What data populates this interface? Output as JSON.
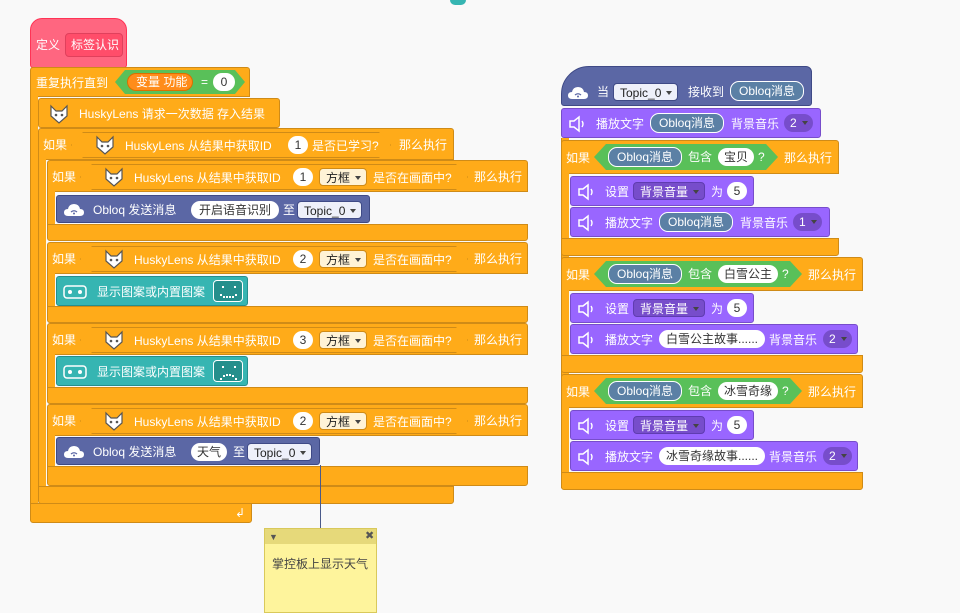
{
  "define": {
    "label": "定义",
    "name": "标签认识"
  },
  "repeat": {
    "label": "重复执行直到",
    "var_label": "变量 功能",
    "op": "=",
    "value": "0"
  },
  "request": {
    "label": "HuskyLens 请求一次数据 存入结果"
  },
  "if_learned": {
    "if": "如果",
    "label": "HuskyLens 从结果中获取ID",
    "id": "1",
    "suffix": "是否已学习?",
    "then": "那么执行"
  },
  "inner_if": [
    {
      "if": "如果",
      "label": "HuskyLens 从结果中获取ID",
      "id": "1",
      "shape": "方框",
      "suffix": "是否在画面中?",
      "then": "那么执行"
    },
    {
      "if": "如果",
      "label": "HuskyLens 从结果中获取ID",
      "id": "2",
      "shape": "方框",
      "suffix": "是否在画面中?",
      "then": "那么执行"
    },
    {
      "if": "如果",
      "label": "HuskyLens 从结果中获取ID",
      "id": "3",
      "shape": "方框",
      "suffix": "是否在画面中?",
      "then": "那么执行"
    },
    {
      "if": "如果",
      "label": "HuskyLens 从结果中获取ID",
      "id": "2",
      "shape": "方框",
      "suffix": "是否在画面中?",
      "then": "那么执行"
    }
  ],
  "obloq_send_1": {
    "label": "Obloq 发送消息",
    "message": "开启语音识别",
    "to": "至",
    "topic": "Topic_0"
  },
  "display_1": {
    "label": "显示图案或内置图案"
  },
  "display_2": {
    "label": "显示图案或内置图案"
  },
  "obloq_send_2": {
    "label": "Obloq 发送消息",
    "message": "天气",
    "to": "至",
    "topic": "Topic_0"
  },
  "comment": {
    "text": "掌控板上显示天气"
  },
  "hat": {
    "when": "当",
    "topic": "Topic_0",
    "received": "接收到",
    "var": "Obloq消息"
  },
  "play_top": {
    "label": "播放文字",
    "var": "Obloq消息",
    "music": "背景音乐",
    "num": "2"
  },
  "cases": [
    {
      "if": "如果",
      "var": "Obloq消息",
      "contains": "包含",
      "keyword": "宝贝",
      "q": "?",
      "then": "那么执行",
      "set": "设置",
      "prop": "背景音量",
      "to": "为",
      "value": "5",
      "play": "播放文字",
      "play_var": "Obloq消息",
      "play_text": "",
      "music": "背景音乐",
      "num": "1"
    },
    {
      "if": "如果",
      "var": "Obloq消息",
      "contains": "包含",
      "keyword": "白雪公主",
      "q": "?",
      "then": "那么执行",
      "set": "设置",
      "prop": "背景音量",
      "to": "为",
      "value": "5",
      "play": "播放文字",
      "play_var": "",
      "play_text": "白雪公主故事......",
      "music": "背景音乐",
      "num": "2"
    },
    {
      "if": "如果",
      "var": "Obloq消息",
      "contains": "包含",
      "keyword": "冰雪奇缘",
      "q": "?",
      "then": "那么执行",
      "set": "设置",
      "prop": "背景音量",
      "to": "为",
      "value": "5",
      "play": "播放文字",
      "play_var": "",
      "play_text": "冰雪奇缘故事......",
      "music": "背景音乐",
      "num": "2"
    }
  ],
  "colors": {
    "define": "#ff6680",
    "control": "#ffab19",
    "control_dark": "#cf8b17",
    "husky": "#ffab19",
    "obloq": "#5b67a5",
    "obloq_var": "#5b80a5",
    "sound": "#9966ff",
    "sound_dark": "#774dcb",
    "display": "#36b5b2",
    "bool": "#59c059",
    "var": "#ff8c1a",
    "comment": "#fef49c"
  }
}
